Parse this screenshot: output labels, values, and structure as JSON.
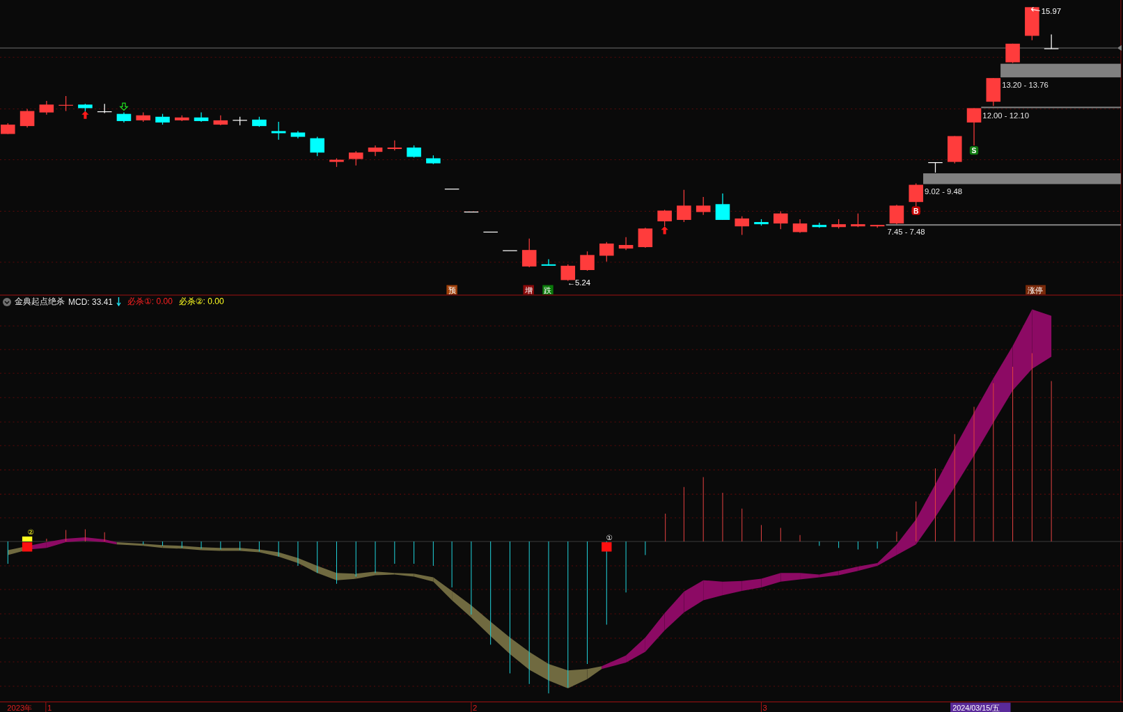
{
  "price_panel": {
    "high_label": "15.97",
    "low_label": "←5.24",
    "zones": [
      {
        "range": "13.20 - 13.76",
        "kind": "band"
      },
      {
        "range": "12.00 - 12.10",
        "kind": "line"
      },
      {
        "range": "9.02 - 9.48",
        "kind": "band"
      },
      {
        "range": "7.45 - 7.48",
        "kind": "line"
      }
    ],
    "signals": [
      {
        "text": "B",
        "kind": "buy"
      },
      {
        "text": "S",
        "kind": "sell"
      }
    ],
    "tags": [
      {
        "text": "预",
        "color": "#a0400a"
      },
      {
        "text": "增",
        "color": "#8b0a0a"
      },
      {
        "text": "跌",
        "color": "#0a7a0a"
      },
      {
        "text": "涨停",
        "color": "#7a2a0a"
      }
    ]
  },
  "indicator": {
    "name": "金典起点绝杀",
    "mcd": "MCD: 33.41",
    "kill_1": "必杀①: 0.00",
    "kill_2": "必杀②: 0.00",
    "markers": [
      "②",
      "①"
    ]
  },
  "time_axis": {
    "year": "2023年",
    "months": [
      "1",
      "2",
      "3"
    ],
    "cursor_date": "2024/03/15/五"
  }
}
